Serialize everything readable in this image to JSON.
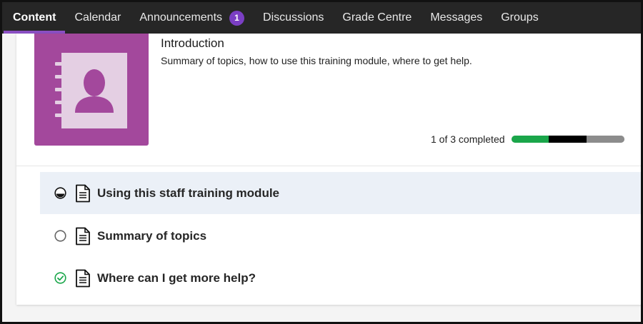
{
  "nav": {
    "tabs": [
      {
        "label": "Content",
        "active": true
      },
      {
        "label": "Calendar"
      },
      {
        "label": "Announcements",
        "badge": "1"
      },
      {
        "label": "Discussions"
      },
      {
        "label": "Grade Centre"
      },
      {
        "label": "Messages"
      },
      {
        "label": "Groups"
      }
    ]
  },
  "module": {
    "thumbnail_icon": "address-book-icon",
    "title": "Introduction",
    "description": "Summary of topics, how to use this training module, where to get help.",
    "progress": {
      "text": "1 of 3 completed",
      "completed": 1,
      "in_progress": 1,
      "total": 3
    },
    "items": [
      {
        "label": "Using this staff training module",
        "status": "in-progress",
        "icon": "document-icon"
      },
      {
        "label": "Summary of topics",
        "status": "not-started",
        "icon": "document-icon"
      },
      {
        "label": "Where can I get more help?",
        "status": "completed",
        "icon": "document-icon"
      }
    ]
  },
  "colors": {
    "nav_bg": "#262626",
    "accent": "#8a4fc3",
    "badge": "#7b3fc4",
    "thumb": "#a3489c",
    "progress_done": "#1aa64a",
    "progress_in_progress": "#000000",
    "progress_remaining": "#8c8c8c",
    "completed_check": "#1aa64a",
    "highlight_row": "#ebf0f7"
  }
}
